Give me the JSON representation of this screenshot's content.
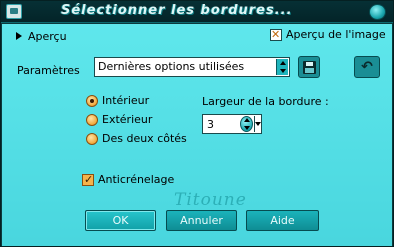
{
  "window": {
    "title": "Sélectionner les bordures..."
  },
  "apercu": {
    "label": "Aperçu",
    "apercu_image_label": "Aperçu de l'image",
    "apercu_image_checked": true
  },
  "parametres": {
    "label": "Paramètres",
    "preset_value": "Dernières options utilisées"
  },
  "position": {
    "options": [
      "Intérieur",
      "Extérieur",
      "Des deux côtés"
    ],
    "selected": "Intérieur"
  },
  "largeur": {
    "label": "Largeur de la bordure :",
    "value": "3"
  },
  "anticrenelage": {
    "label": "Anticrénelage",
    "checked": true
  },
  "watermark": "Titoune",
  "buttons": {
    "ok": "OK",
    "cancel": "Annuler",
    "help": "Aide"
  },
  "colors": {
    "panel": "#4fe0e6",
    "frame": "#0b3a3d",
    "button": "#14a2a9",
    "accent_orange": "#f3a93a"
  }
}
